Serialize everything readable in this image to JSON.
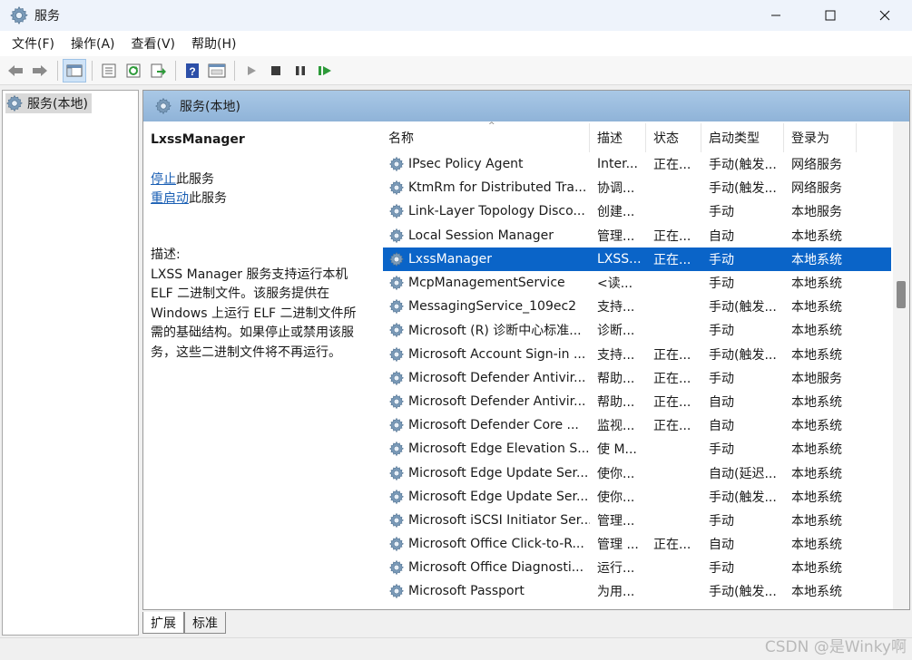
{
  "window": {
    "title": "服务",
    "controls": [
      "minimize",
      "maximize",
      "close"
    ]
  },
  "menu": [
    "文件(F)",
    "操作(A)",
    "查看(V)",
    "帮助(H)"
  ],
  "toolbar_icons": [
    "back-icon",
    "forward-icon",
    "console-tree-icon",
    "properties-icon",
    "refresh-icon",
    "export-icon",
    "help-icon",
    "view-icon",
    "start-icon",
    "stop-icon",
    "pause-icon",
    "restart-icon"
  ],
  "tree": {
    "item": "服务(本地)"
  },
  "panel": {
    "header": "服务(本地)"
  },
  "detail": {
    "name": "LxssManager",
    "stop_link": "停止",
    "stop_suffix": "此服务",
    "restart_link": "重启动",
    "restart_suffix": "此服务",
    "desc_label": "描述:",
    "desc_lines": [
      "LXSS Manager 服务支持运行本机",
      "ELF 二进制文件。该服务提供在",
      "Windows 上运行 ELF 二进制文件所",
      "需的基础结构。如果停止或禁用该服",
      "务，这些二进制文件将不再运行。"
    ]
  },
  "columns": {
    "name": "名称",
    "desc": "描述",
    "status": "状态",
    "start": "启动类型",
    "logon": "登录为"
  },
  "rows": [
    {
      "name": "IPsec Policy Agent",
      "desc": "Inter...",
      "status": "正在...",
      "start": "手动(触发...",
      "logon": "网络服务"
    },
    {
      "name": "KtmRm for Distributed Tra...",
      "desc": "协调...",
      "status": "",
      "start": "手动(触发...",
      "logon": "网络服务"
    },
    {
      "name": "Link-Layer Topology Disco...",
      "desc": "创建...",
      "status": "",
      "start": "手动",
      "logon": "本地服务"
    },
    {
      "name": "Local Session Manager",
      "desc": "管理...",
      "status": "正在...",
      "start": "自动",
      "logon": "本地系统"
    },
    {
      "name": "LxssManager",
      "desc": "LXSS...",
      "status": "正在...",
      "start": "手动",
      "logon": "本地系统",
      "selected": true
    },
    {
      "name": "McpManagementService",
      "desc": "<读...",
      "status": "",
      "start": "手动",
      "logon": "本地系统"
    },
    {
      "name": "MessagingService_109ec2",
      "desc": "支持...",
      "status": "",
      "start": "手动(触发...",
      "logon": "本地系统"
    },
    {
      "name": "Microsoft (R) 诊断中心标准...",
      "desc": "诊断...",
      "status": "",
      "start": "手动",
      "logon": "本地系统"
    },
    {
      "name": "Microsoft Account Sign-in ...",
      "desc": "支持...",
      "status": "正在...",
      "start": "手动(触发...",
      "logon": "本地系统"
    },
    {
      "name": "Microsoft Defender Antivir...",
      "desc": "帮助...",
      "status": "正在...",
      "start": "手动",
      "logon": "本地服务"
    },
    {
      "name": "Microsoft Defender Antivir...",
      "desc": "帮助...",
      "status": "正在...",
      "start": "自动",
      "logon": "本地系统"
    },
    {
      "name": "Microsoft Defender Core ...",
      "desc": "监视...",
      "status": "正在...",
      "start": "自动",
      "logon": "本地系统"
    },
    {
      "name": "Microsoft Edge Elevation S...",
      "desc": "使 M...",
      "status": "",
      "start": "手动",
      "logon": "本地系统"
    },
    {
      "name": "Microsoft Edge Update Ser...",
      "desc": "使你...",
      "status": "",
      "start": "自动(延迟...",
      "logon": "本地系统"
    },
    {
      "name": "Microsoft Edge Update Ser...",
      "desc": "使你...",
      "status": "",
      "start": "手动(触发...",
      "logon": "本地系统"
    },
    {
      "name": "Microsoft iSCSI Initiator Ser...",
      "desc": "管理...",
      "status": "",
      "start": "手动",
      "logon": "本地系统"
    },
    {
      "name": "Microsoft Office Click-to-R...",
      "desc": "管理 ...",
      "status": "正在...",
      "start": "自动",
      "logon": "本地系统"
    },
    {
      "name": "Microsoft Office Diagnosti...",
      "desc": "运行...",
      "status": "",
      "start": "手动",
      "logon": "本地系统"
    },
    {
      "name": "Microsoft Passport",
      "desc": "为用...",
      "status": "",
      "start": "手动(触发...",
      "logon": "本地系统"
    }
  ],
  "tabs": [
    "扩展",
    "标准"
  ],
  "watermark": "CSDN @是Winky啊",
  "colors": {
    "selected": "#0a64c8",
    "header": "#9dbde0",
    "link": "#1a5fb4"
  }
}
